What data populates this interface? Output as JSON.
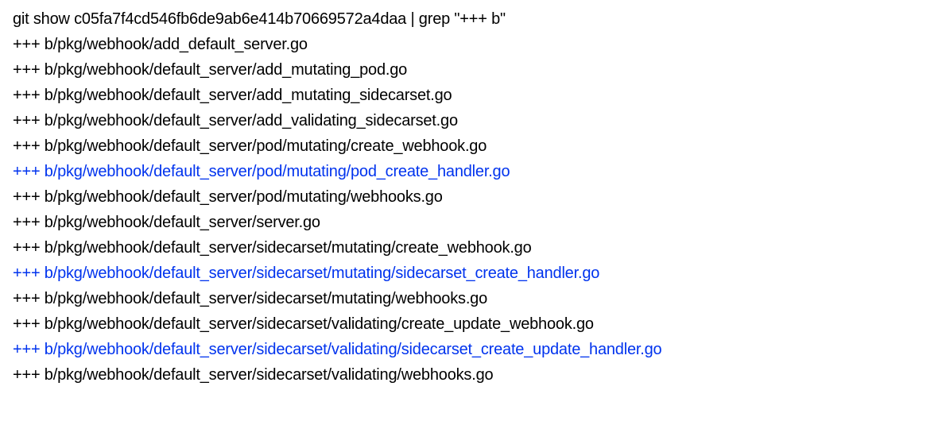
{
  "command": "git show c05fa7f4cd546fb6de9ab6e414b70669572a4daa | grep \"+++ b\"",
  "lines": [
    {
      "text": "+++ b/pkg/webhook/add_default_server.go",
      "highlight": false
    },
    {
      "text": "+++ b/pkg/webhook/default_server/add_mutating_pod.go",
      "highlight": false
    },
    {
      "text": "+++ b/pkg/webhook/default_server/add_mutating_sidecarset.go",
      "highlight": false
    },
    {
      "text": "+++ b/pkg/webhook/default_server/add_validating_sidecarset.go",
      "highlight": false
    },
    {
      "text": "+++ b/pkg/webhook/default_server/pod/mutating/create_webhook.go",
      "highlight": false
    },
    {
      "text": "+++ b/pkg/webhook/default_server/pod/mutating/pod_create_handler.go",
      "highlight": true
    },
    {
      "text": "+++ b/pkg/webhook/default_server/pod/mutating/webhooks.go",
      "highlight": false
    },
    {
      "text": "+++ b/pkg/webhook/default_server/server.go",
      "highlight": false
    },
    {
      "text": "+++ b/pkg/webhook/default_server/sidecarset/mutating/create_webhook.go",
      "highlight": false
    },
    {
      "text": "+++ b/pkg/webhook/default_server/sidecarset/mutating/sidecarset_create_handler.go",
      "highlight": true
    },
    {
      "text": "+++ b/pkg/webhook/default_server/sidecarset/mutating/webhooks.go",
      "highlight": false
    },
    {
      "text": "+++ b/pkg/webhook/default_server/sidecarset/validating/create_update_webhook.go",
      "highlight": false
    },
    {
      "text": "+++ b/pkg/webhook/default_server/sidecarset/validating/sidecarset_create_update_handler.go",
      "highlight": true
    },
    {
      "text": "+++ b/pkg/webhook/default_server/sidecarset/validating/webhooks.go",
      "highlight": false
    }
  ]
}
